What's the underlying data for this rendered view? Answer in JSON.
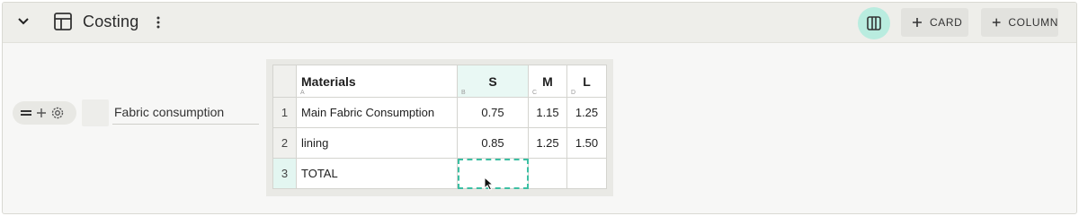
{
  "header": {
    "title": "Costing",
    "card_button_label": "CARD",
    "column_button_label": "COLUMN"
  },
  "icons": {
    "collapse": "chevron-down-icon",
    "layout": "layout-table-icon",
    "more": "more-vertical-icon",
    "columns_view": "columns-view-icon",
    "plus": "plus-icon",
    "drag": "drag-handle-icon",
    "add": "plus-icon",
    "settings": "gear-icon",
    "cursor": "mouse-pointer-icon"
  },
  "colors": {
    "accent": "#3cbfa3",
    "accent_bg": "#b9ecdf"
  },
  "field": {
    "label": "Fabric consumption"
  },
  "sheet": {
    "columns": [
      {
        "label": "Materials",
        "letter": "A"
      },
      {
        "label": "S",
        "letter": "B"
      },
      {
        "label": "M",
        "letter": "C"
      },
      {
        "label": "L",
        "letter": "D"
      }
    ],
    "rows": [
      {
        "num": "1",
        "material": "Main Fabric Consumption",
        "s": "0.75",
        "m": "1.15",
        "l": "1.25"
      },
      {
        "num": "2",
        "material": "lining",
        "s": "0.85",
        "m": "1.25",
        "l": "1.50"
      },
      {
        "num": "3",
        "material": "TOTAL",
        "s": "",
        "m": "",
        "l": ""
      }
    ]
  }
}
